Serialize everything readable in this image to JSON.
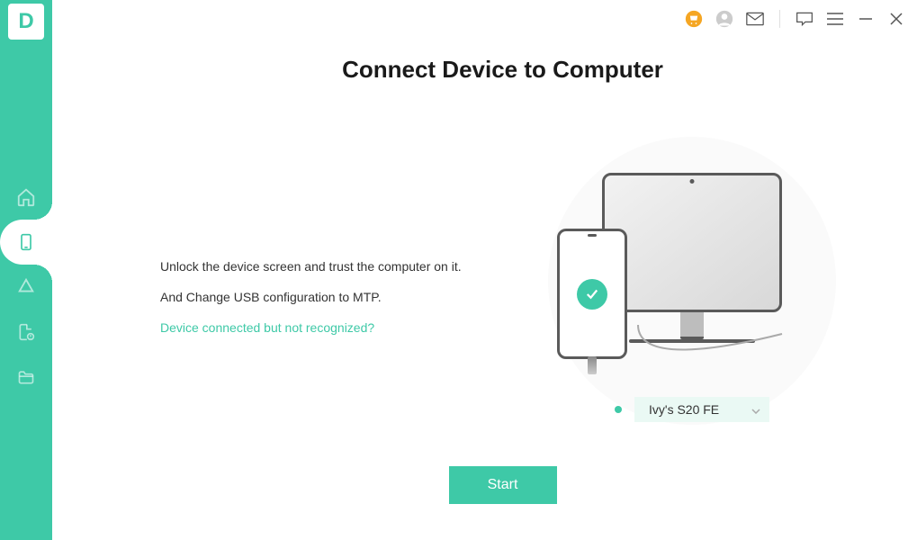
{
  "logo_letter": "D",
  "page_title": "Connect Device to Computer",
  "instructions": {
    "line1": "Unlock the device screen and trust the computer on it.",
    "line2": "And Change USB configuration to MTP.",
    "help_link": "Device connected but not recognized?"
  },
  "device_selector": {
    "selected": "Ivy's S20 FE"
  },
  "start_button": "Start",
  "colors": {
    "accent": "#3ec9a7",
    "shop_icon": "#f5a623"
  }
}
